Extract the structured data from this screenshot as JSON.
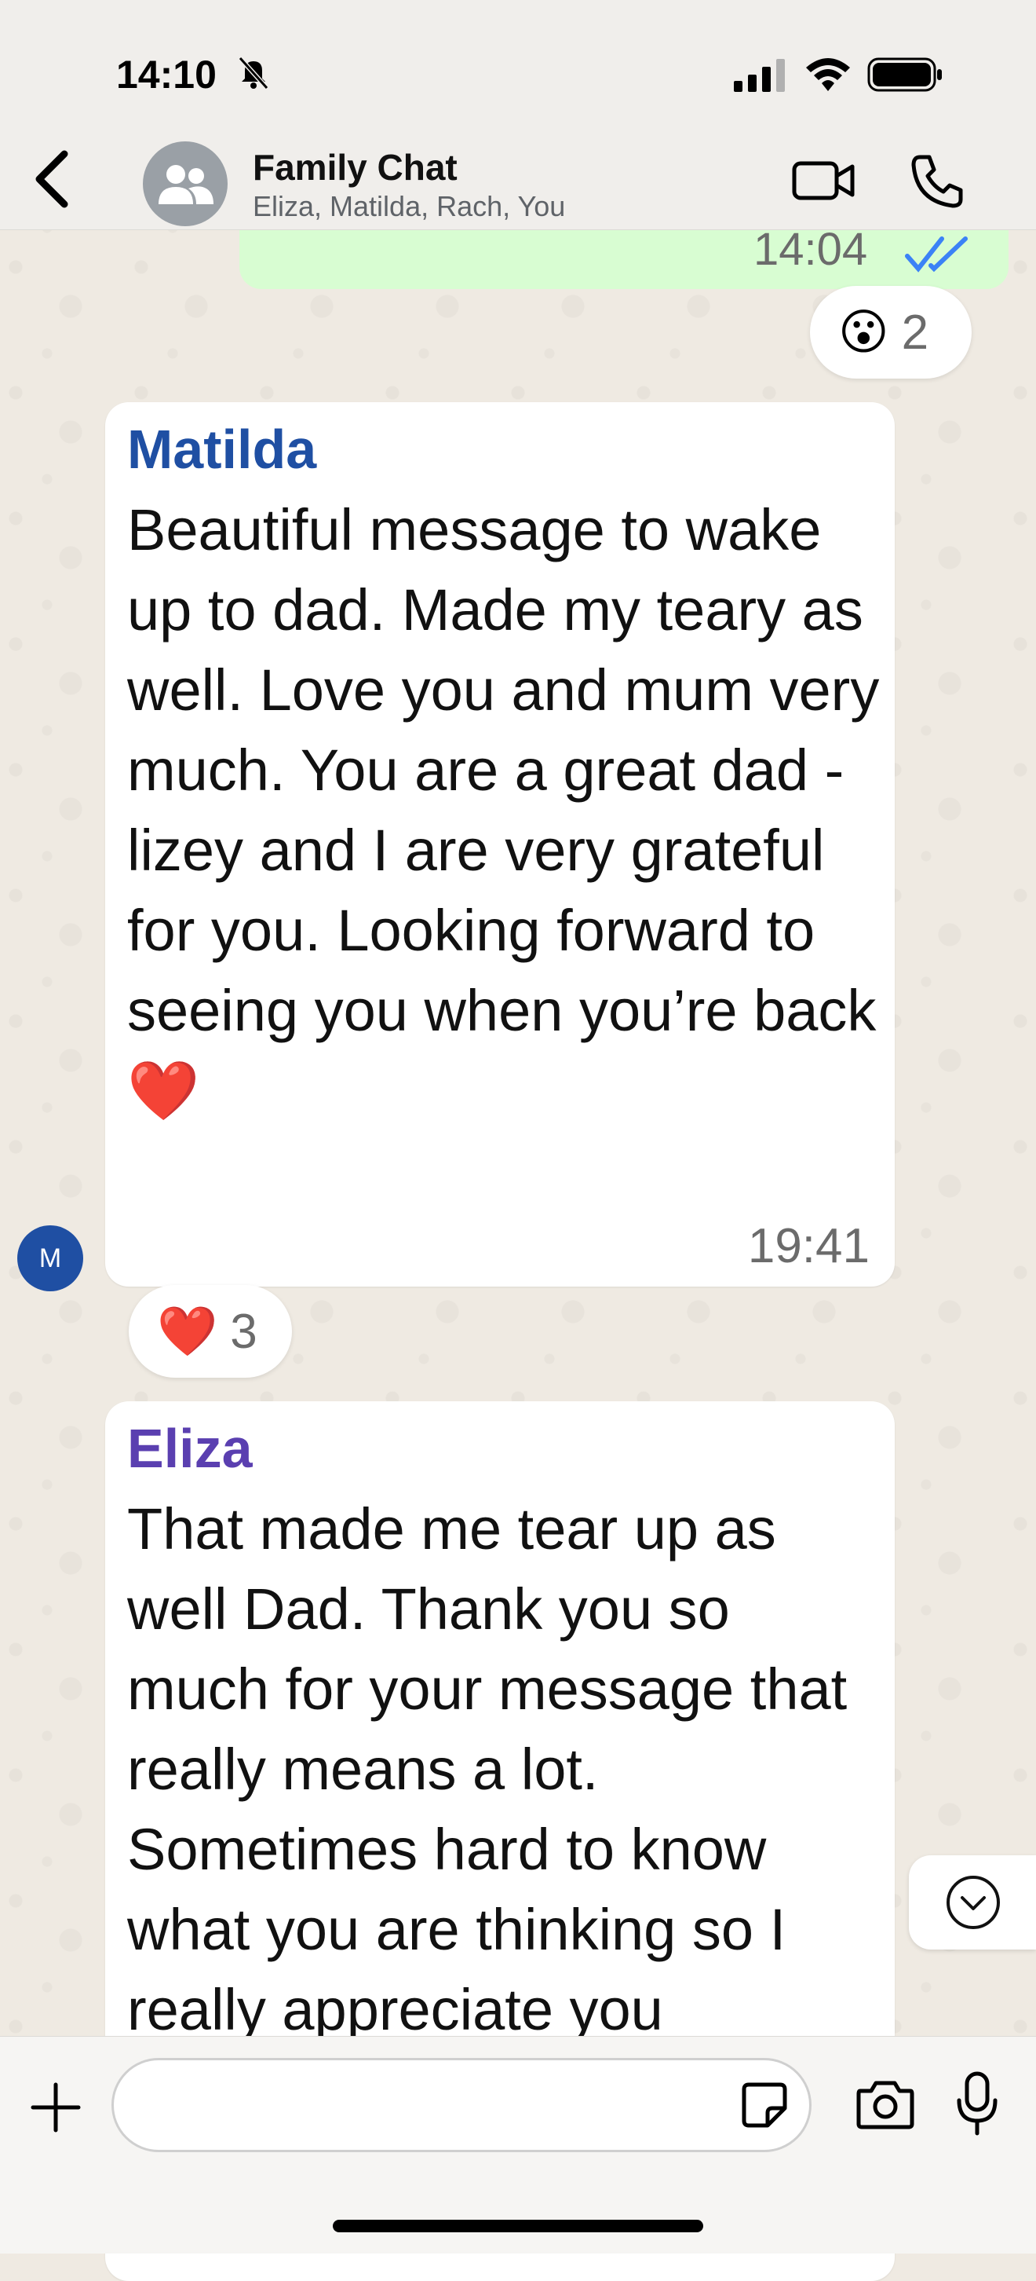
{
  "status_bar": {
    "time": "14:10"
  },
  "header": {
    "title": "Family Chat",
    "subtitle": "Eliza, Matilda, Rach, You"
  },
  "outgoing": {
    "time": "14:04",
    "reaction": {
      "emoji": "😮",
      "count": "2"
    }
  },
  "messages": [
    {
      "sender": "Matilda",
      "sender_color": "#1f4fa3",
      "avatar_initial": "M",
      "text": "Beautiful message to wake up to dad. Made my teary as well. Love you and mum very much. You are a great dad - lizey and I are very grateful for you. Looking forward to seeing you when you’re back ❤️",
      "time": "19:41",
      "reaction": {
        "emoji": "❤️",
        "count": "3"
      }
    },
    {
      "sender": "Eliza",
      "sender_color": "#5a3fb0",
      "text": "That made me tear up as well Dad. Thank you so much for your message that really means a lot. Sometimes hard to know what you are thinking so I really appreciate you"
    }
  ],
  "composer": {
    "placeholder": ""
  },
  "icons": {
    "back": "chevron-left-icon",
    "video": "video-camera-icon",
    "call": "phone-icon",
    "plus": "plus-icon",
    "sticker": "sticker-icon",
    "camera": "camera-icon",
    "mic": "microphone-icon",
    "scroll": "chevron-down-circle-icon"
  },
  "colors": {
    "accent_blue": "#1f4fa3",
    "outgoing_bubble": "#d8fdd2",
    "tick_blue": "#3b82f6"
  }
}
